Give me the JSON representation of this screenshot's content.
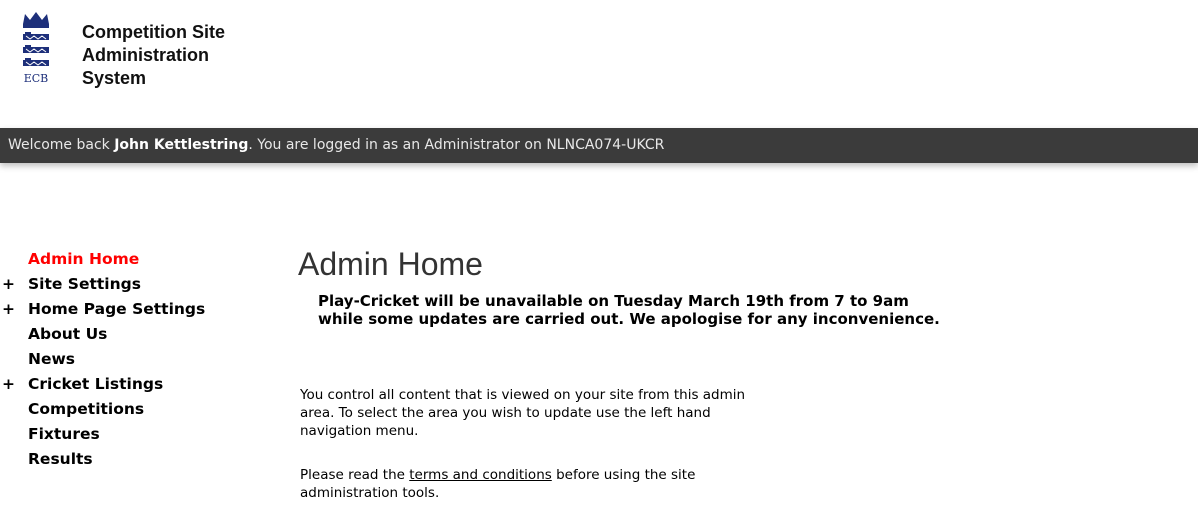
{
  "header": {
    "logo_text": "ECB",
    "title_lines": [
      "Competition Site",
      "Administration",
      "System"
    ]
  },
  "welcome": {
    "prefix": "Welcome back ",
    "user": "John Kettlestring",
    "suffix": ". You are logged in as an Administrator on NLNCA074-UKCR"
  },
  "sidebar": {
    "items": [
      {
        "prefix": "",
        "label": "Admin Home",
        "active": true
      },
      {
        "prefix": "+",
        "label": "Site Settings"
      },
      {
        "prefix": "+",
        "label": "Home Page Settings"
      },
      {
        "prefix": "",
        "label": "About Us"
      },
      {
        "prefix": "",
        "label": "News"
      },
      {
        "prefix": "+",
        "label": "Cricket Listings"
      },
      {
        "prefix": "",
        "label": "Competitions"
      },
      {
        "prefix": "",
        "label": "Fixtures"
      },
      {
        "prefix": "",
        "label": "Results"
      }
    ]
  },
  "main": {
    "title": "Admin Home",
    "notice_lines": [
      "Play-Cricket will be unavailable on Tuesday March 19th from 7 to 9am",
      "while some updates are carried out. We apologise for any inconvenience."
    ],
    "intro_lines": [
      "You control all content that is viewed on your site from this admin",
      "area. To select the area you wish to update use the left hand",
      "navigation menu."
    ],
    "terms_before": "Please read the ",
    "terms_link": "terms and conditions",
    "terms_after": " before using the site",
    "terms_line2": "administration tools."
  },
  "colors": {
    "active_nav": "#ff0000",
    "bar": "#3b3b3b"
  }
}
